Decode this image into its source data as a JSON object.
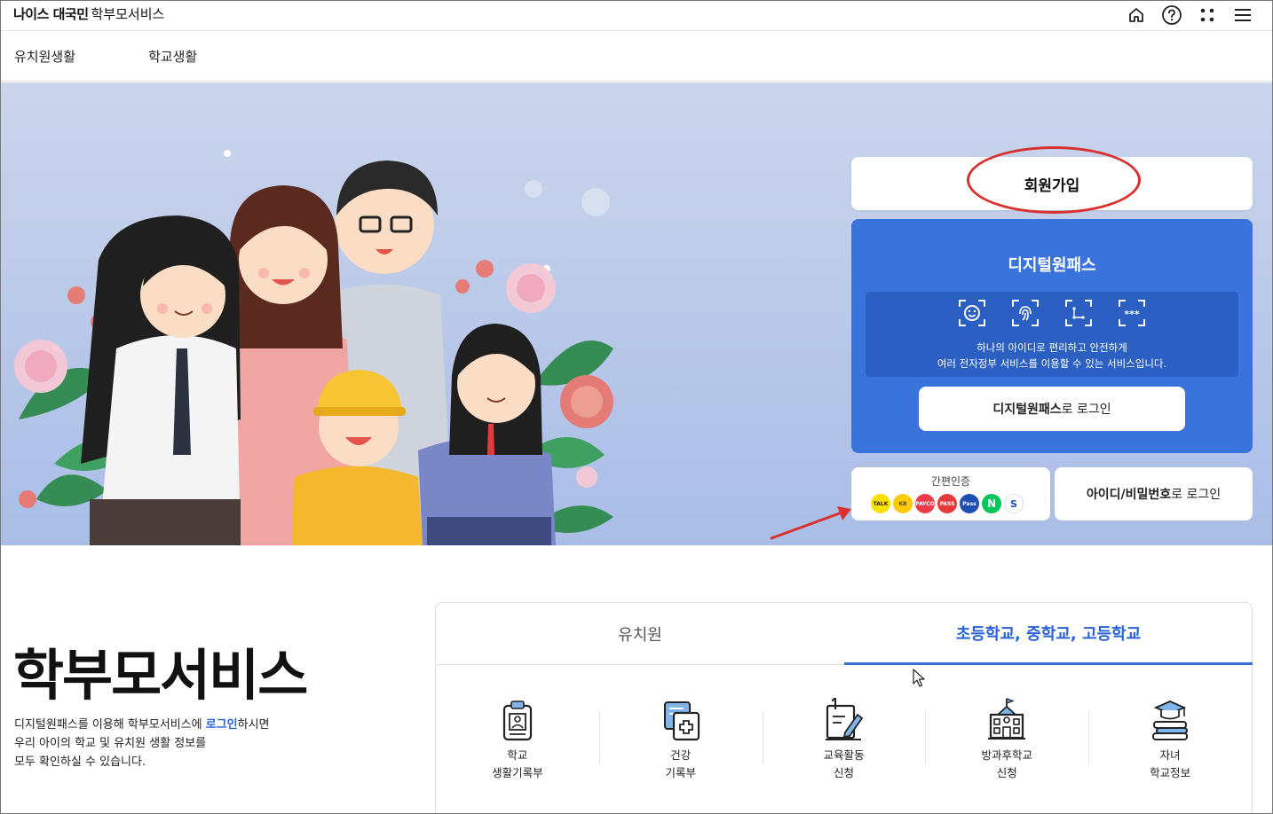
{
  "header": {
    "brand": "나이스 대국민",
    "service": "학부모서비스",
    "icons": [
      "home-icon",
      "help-icon",
      "apps-grid-icon",
      "menu-icon"
    ]
  },
  "nav": {
    "items": [
      "유치원생활",
      "학교생활"
    ]
  },
  "hero": {
    "join_label": "회원가입",
    "digital_pass": {
      "title": "디지털원패스",
      "desc_line1": "하나의 아이디로 편리하고 안전하게",
      "desc_line2": "여러 전자정부 서비스를 이용할 수 있는 서비스입니다.",
      "login_bold": "디지털원패스",
      "login_rest": "로 로그인"
    },
    "easy_auth": {
      "label": "간편인증",
      "providers": [
        "TALK",
        "KB",
        "PAYCO",
        "PASS",
        "Pass",
        "N",
        "S"
      ]
    },
    "id_login": {
      "bold": "아이디/비밀번호",
      "rest": "로 로그인"
    }
  },
  "intro": {
    "title": "학부모서비스",
    "line1_pre": "디지털원패스를 이용해 학부모서비스에 ",
    "line1_link": "로그인",
    "line1_post": "하시면",
    "line2": "우리 아이의 학교 및 유치원 생활 정보를",
    "line3": "모두 확인하실 수 있습니다."
  },
  "tabs": {
    "kindergarten": "유치원",
    "school": "초등학교, 중학교, 고등학교"
  },
  "services": [
    {
      "line1": "학교",
      "line2": "생활기록부"
    },
    {
      "line1": "건강",
      "line2": "기록부"
    },
    {
      "line1": "교육활동",
      "line2": "신청"
    },
    {
      "line1": "방과후학교",
      "line2": "신청"
    },
    {
      "line1": "자녀",
      "line2": "학교정보"
    }
  ],
  "colors": {
    "primary": "#3b73dc",
    "accent_text": "#2a62d8",
    "annotation": "#d8312f"
  }
}
